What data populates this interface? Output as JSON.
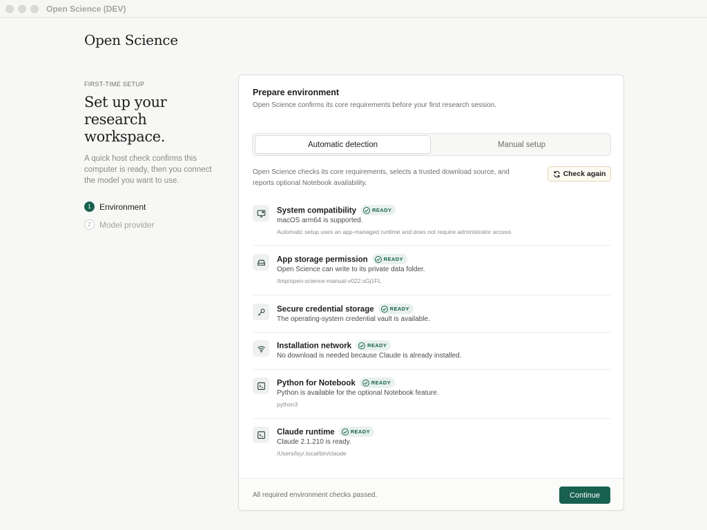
{
  "window": {
    "title": "Open Science (DEV)"
  },
  "brand": "Open Science",
  "sidebar": {
    "eyebrow": "FIRST-TIME SETUP",
    "headline": "Set up your research workspace.",
    "intro": "A quick host check confirms this computer is ready, then you connect the model you want to use.",
    "steps": [
      {
        "num": "1",
        "label": "Environment",
        "active": true
      },
      {
        "num": "2",
        "label": "Model provider",
        "active": false
      }
    ]
  },
  "card": {
    "title": "Prepare environment",
    "subtitle": "Open Science confirms its core requirements before your first research session.",
    "tabs": [
      {
        "label": "Automatic detection",
        "selected": true
      },
      {
        "label": "Manual setup",
        "selected": false
      }
    ],
    "description": "Open Science checks its core requirements, selects a trusted download source, and reports optional Notebook availability.",
    "check_again_label": "Check again",
    "checks": [
      {
        "icon": "monitor-icon",
        "title": "System compatibility",
        "status": "READY",
        "desc": "macOS arm64 is supported.",
        "detail": "Automatic setup uses an app-managed runtime and does not require administrator access."
      },
      {
        "icon": "drive-icon",
        "title": "App storage permission",
        "status": "READY",
        "desc": "Open Science can write to its private data folder.",
        "detail": "/tmp/open-science-manual-v022.sGj1FL"
      },
      {
        "icon": "key-icon",
        "title": "Secure credential storage",
        "status": "READY",
        "desc": "The operating-system credential vault is available.",
        "detail": ""
      },
      {
        "icon": "wifi-icon",
        "title": "Installation network",
        "status": "READY",
        "desc": "No download is needed because Claude is already installed.",
        "detail": ""
      },
      {
        "icon": "terminal-icon",
        "title": "Python for Notebook",
        "status": "READY",
        "desc": "Python is available for the optional Notebook feature.",
        "detail": "python3"
      },
      {
        "icon": "terminal-icon",
        "title": "Claude runtime",
        "status": "READY",
        "desc": "Claude 2.1.210 is ready.",
        "detail": "/Users/lsy/.local/bin/claude"
      }
    ],
    "footer_text": "All required environment checks passed.",
    "continue_label": "Continue"
  },
  "colors": {
    "accent": "#19614f",
    "badge_bg": "#e8f1ec"
  }
}
